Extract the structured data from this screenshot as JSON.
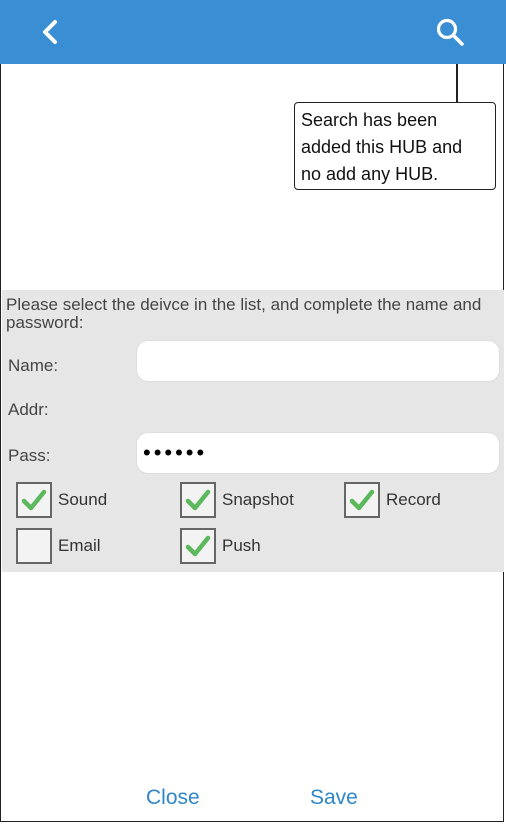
{
  "colors": {
    "appbar": "#3a8fd4",
    "accent": "#2f86c9",
    "panel": "#e6e6e6",
    "check": "#5cb85c"
  },
  "appbar": {
    "back_icon": "chevron-left-icon",
    "search_icon": "search-icon"
  },
  "callout": {
    "lines": [
      "Search has been",
      "added this HUB and",
      "no add any HUB."
    ]
  },
  "form": {
    "instructions": "Please select the deivce in the list, and complete the name and password:",
    "name_label": "Name:",
    "name_value": "",
    "addr_label": "Addr:",
    "pass_label": "Pass:",
    "pass_value": "••••••"
  },
  "options": [
    {
      "label": "Sound",
      "checked": true
    },
    {
      "label": "Snapshot",
      "checked": true
    },
    {
      "label": "Record",
      "checked": true
    },
    {
      "label": "Email",
      "checked": false
    },
    {
      "label": "Push",
      "checked": true
    }
  ],
  "footer": {
    "close_label": "Close",
    "save_label": "Save"
  }
}
